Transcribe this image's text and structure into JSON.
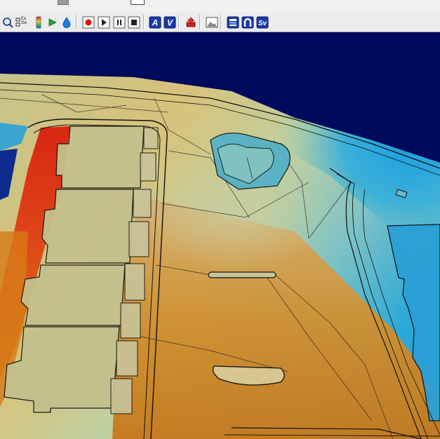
{
  "toolbar": {
    "exde_top": "Ex",
    "exde_bottom": "De",
    "buttons": [
      {
        "name": "zoom-magnifier-icon"
      },
      {
        "name": "expand-deform-icon"
      },
      {
        "name": "color-legend-icon"
      },
      {
        "name": "play-green-icon"
      },
      {
        "name": "drop-water-icon"
      },
      {
        "name": "record-icon"
      },
      {
        "name": "step-play-icon"
      },
      {
        "name": "pause-icon"
      },
      {
        "name": "stop-icon"
      },
      {
        "name": "label-a-icon",
        "text": "A"
      },
      {
        "name": "label-v-icon",
        "text": "V"
      },
      {
        "name": "export-red-icon"
      },
      {
        "name": "image-icon"
      },
      {
        "name": "layer-stack-icon"
      },
      {
        "name": "magnet-u-icon"
      },
      {
        "name": "sv-icon",
        "text": "Sv"
      }
    ]
  },
  "colors": {
    "background": "#000a5c",
    "surface_low": "#cc7a1a",
    "surface_mid": "#c9c98a",
    "surface_high": "#2aa8d8",
    "hotspot": "#d42a10"
  }
}
